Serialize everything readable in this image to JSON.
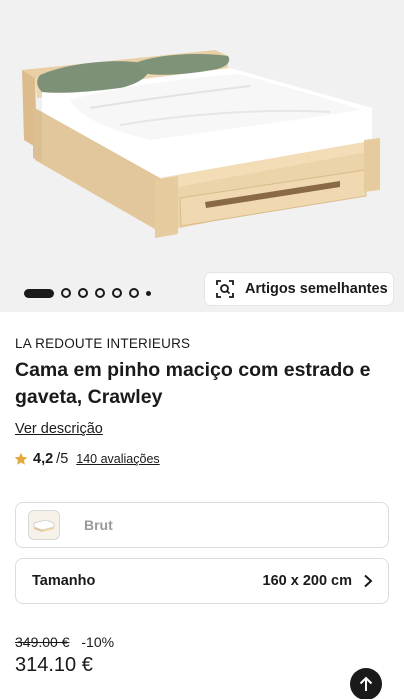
{
  "gallery": {
    "image_alt": "bed-product-photo",
    "dots_total": 7,
    "active_index": 0,
    "similar_button_label": "Artigos semelhantes",
    "background": "#f1f1f1"
  },
  "product": {
    "brand": "LA REDOUTE INTERIEURS",
    "title": "Cama em pinho maciço com estrado e gaveta, Crawley",
    "description_link": "Ver descrição",
    "rating": {
      "score": "4,2",
      "max": "/5",
      "reviews": "140 avaliações",
      "star_color": "#e2a93b"
    }
  },
  "options": {
    "variant": {
      "name": "Brut"
    },
    "size": {
      "label": "Tamanho",
      "value": "160 x 200 cm"
    }
  },
  "pricing": {
    "old_price": "349.00 €",
    "discount": "-10%",
    "price": "314.10 €"
  },
  "icons": {
    "similar": "visual-search-icon",
    "star": "star-icon",
    "chevron": "chevron-right-icon",
    "back_to_top": "arrow-up-icon"
  }
}
